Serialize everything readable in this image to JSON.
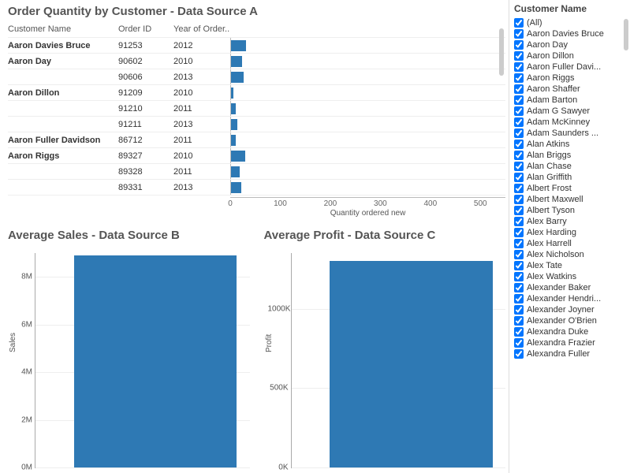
{
  "top": {
    "title": "Order Quantity by Customer - Data Source A",
    "headers": {
      "customer": "Customer Name",
      "order": "Order ID",
      "year": "Year of Order.."
    },
    "xlabel": "Quantity ordered new",
    "xmax": 550,
    "ticks": [
      0,
      100,
      200,
      300,
      400,
      500
    ]
  },
  "chart_data": [
    {
      "type": "bar",
      "title": "Order Quantity by Customer - Data Source A",
      "xlabel": "Quantity ordered new",
      "xlim": [
        0,
        550
      ],
      "rows": [
        {
          "customer": "Aaron Davies Bruce",
          "order": "91253",
          "year": "2012",
          "qty": 30
        },
        {
          "customer": "Aaron Day",
          "order": "90602",
          "year": "2010",
          "qty": 22
        },
        {
          "customer": "",
          "order": "90606",
          "year": "2013",
          "qty": 26
        },
        {
          "customer": "Aaron Dillon",
          "order": "91209",
          "year": "2010",
          "qty": 4
        },
        {
          "customer": "",
          "order": "91210",
          "year": "2011",
          "qty": 10
        },
        {
          "customer": "",
          "order": "91211",
          "year": "2013",
          "qty": 12
        },
        {
          "customer": "Aaron Fuller Davidson",
          "order": "86712",
          "year": "2011",
          "qty": 10
        },
        {
          "customer": "Aaron Riggs",
          "order": "89327",
          "year": "2010",
          "qty": 28
        },
        {
          "customer": "",
          "order": "89328",
          "year": "2011",
          "qty": 18
        },
        {
          "customer": "",
          "order": "89331",
          "year": "2013",
          "qty": 20
        }
      ]
    },
    {
      "type": "bar",
      "title": "Average Sales - Data Source B",
      "ylabel": "Sales",
      "ylim": [
        0,
        9000000
      ],
      "yticks": [
        0,
        2000000,
        4000000,
        6000000,
        8000000
      ],
      "ytick_labels": [
        "0M",
        "2M",
        "4M",
        "6M",
        "8M"
      ],
      "values": [
        8900000
      ]
    },
    {
      "type": "bar",
      "title": "Average Profit - Data Source C",
      "ylabel": "Profit",
      "ylim": [
        0,
        1350000
      ],
      "yticks": [
        0,
        500000,
        1000000
      ],
      "ytick_labels": [
        "0K",
        "500K",
        "1000K"
      ],
      "values": [
        1300000
      ]
    }
  ],
  "sales": {
    "title": "Average Sales - Data Source B",
    "ylabel": "Sales"
  },
  "profit": {
    "title": "Average Profit - Data Source C",
    "ylabel": "Profit"
  },
  "filter": {
    "title": "Customer Name",
    "items": [
      "(All)",
      "Aaron Davies Bruce",
      "Aaron Day",
      "Aaron Dillon",
      "Aaron Fuller Davi...",
      "Aaron Riggs",
      "Aaron Shaffer",
      "Adam Barton",
      "Adam G Sawyer",
      "Adam McKinney",
      "Adam Saunders ...",
      "Alan Atkins",
      "Alan Briggs",
      "Alan Chase",
      "Alan Griffith",
      "Albert Frost",
      "Albert Maxwell",
      "Albert Tyson",
      "Alex Barry",
      "Alex Harding",
      "Alex Harrell",
      "Alex Nicholson",
      "Alex Tate",
      "Alex Watkins",
      "Alexander Baker",
      "Alexander Hendri...",
      "Alexander Joyner",
      "Alexander O'Brien",
      "Alexandra Duke",
      "Alexandra Frazier",
      "Alexandra Fuller"
    ]
  }
}
